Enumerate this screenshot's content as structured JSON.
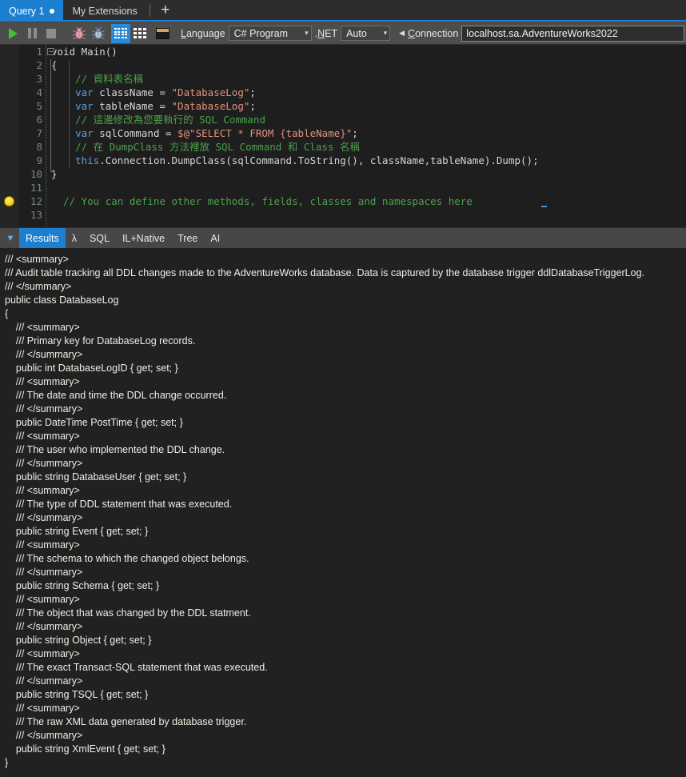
{
  "tabs": {
    "items": [
      {
        "label": "Query 1",
        "active": true,
        "dirty": true
      },
      {
        "label": "My Extensions",
        "active": false,
        "dirty": false
      }
    ],
    "add_label": "+"
  },
  "toolbar": {
    "icons": [
      {
        "name": "run-icon",
        "glyph": "play"
      },
      {
        "name": "pause-icon",
        "glyph": "pause"
      },
      {
        "name": "stop-icon",
        "glyph": "stop"
      },
      {
        "name": "debug-bug-pink-icon",
        "glyph": "bug-pink"
      },
      {
        "name": "debug-bug-blue-icon",
        "glyph": "bug-blue"
      },
      {
        "name": "results-grid-active-icon",
        "glyph": "grid4"
      },
      {
        "name": "results-grid-icon",
        "glyph": "grid3"
      },
      {
        "name": "panel-layout-icon",
        "glyph": "panel"
      }
    ],
    "language_label": "Language",
    "language_label_accesskey": "L",
    "language_value": "C# Program",
    "net_label": ".NET",
    "net_label_accesskey": "N",
    "net_value": "Auto",
    "connection_label": "Connection",
    "connection_label_accesskey": "C",
    "connection_value": "localhost.sa.AdventureWorks2022"
  },
  "editor": {
    "line_numbers": [
      "1",
      "2",
      "3",
      "4",
      "5",
      "6",
      "7",
      "8",
      "9",
      "10",
      "11",
      "12",
      "13"
    ],
    "lines": [
      [
        {
          "t": "void Main()",
          "c": "pln"
        }
      ],
      [
        {
          "t": "{",
          "c": "pln"
        }
      ],
      [
        {
          "t": "    // 資料表名稱",
          "c": "cmt"
        }
      ],
      [
        {
          "t": "    ",
          "c": "pln"
        },
        {
          "t": "var",
          "c": "kw"
        },
        {
          "t": " className = ",
          "c": "pln"
        },
        {
          "t": "\"DatabaseLog\"",
          "c": "str"
        },
        {
          "t": ";",
          "c": "pln"
        }
      ],
      [
        {
          "t": "    ",
          "c": "pln"
        },
        {
          "t": "var",
          "c": "kw"
        },
        {
          "t": " tableName = ",
          "c": "pln"
        },
        {
          "t": "\"DatabaseLog\"",
          "c": "str"
        },
        {
          "t": ";",
          "c": "pln"
        }
      ],
      [
        {
          "t": "    // 這邊修改為您要執行的 SQL Command",
          "c": "cmt"
        }
      ],
      [
        {
          "t": "    ",
          "c": "pln"
        },
        {
          "t": "var",
          "c": "kw"
        },
        {
          "t": " sqlCommand = ",
          "c": "pln"
        },
        {
          "t": "$@\"SELECT * FROM {tableName}\"",
          "c": "str"
        },
        {
          "t": ";",
          "c": "pln"
        }
      ],
      [
        {
          "t": "    // 在 DumpClass 方法裡放 SQL Command 和 Class 名稱",
          "c": "cmt"
        }
      ],
      [
        {
          "t": "    ",
          "c": "pln"
        },
        {
          "t": "this",
          "c": "kw"
        },
        {
          "t": ".Connection.DumpClass(sqlCommand.ToString(), className,tableName).Dump();",
          "c": "pln"
        }
      ],
      [
        {
          "t": "}",
          "c": "pln"
        }
      ],
      [
        {
          "t": "",
          "c": "pln"
        }
      ],
      [
        {
          "t": "  // You can define other methods, fields, classes and namespaces here",
          "c": "cmt"
        }
      ],
      [
        {
          "t": "",
          "c": "pln"
        }
      ]
    ],
    "bulb_line": 12,
    "bulb_name": "lightbulb-suggestion-icon"
  },
  "results_tabs": {
    "collapse_icon": "▼",
    "items": [
      {
        "label": "Results",
        "active": true
      },
      {
        "label": "λ",
        "active": false
      },
      {
        "label": "SQL",
        "active": false
      },
      {
        "label": "IL+Native",
        "active": false
      },
      {
        "label": "Tree",
        "active": false
      },
      {
        "label": "AI",
        "active": false
      }
    ]
  },
  "results": {
    "lines": [
      "/// <summary>",
      "/// Audit table tracking all DDL changes made to the AdventureWorks database. Data is captured by the database trigger ddlDatabaseTriggerLog.",
      "/// </summary>",
      "public class DatabaseLog",
      "{",
      "    /// <summary>",
      "    /// Primary key for DatabaseLog records.",
      "    /// </summary>",
      "    public int DatabaseLogID { get; set; }",
      "    /// <summary>",
      "    /// The date and time the DDL change occurred.",
      "    /// </summary>",
      "    public DateTime PostTime { get; set; }",
      "    /// <summary>",
      "    /// The user who implemented the DDL change.",
      "    /// </summary>",
      "    public string DatabaseUser { get; set; }",
      "    /// <summary>",
      "    /// The type of DDL statement that was executed.",
      "    /// </summary>",
      "    public string Event { get; set; }",
      "    /// <summary>",
      "    /// The schema to which the changed object belongs.",
      "    /// </summary>",
      "    public string Schema { get; set; }",
      "    /// <summary>",
      "    /// The object that was changed by the DDL statment.",
      "    /// </summary>",
      "    public string Object { get; set; }",
      "    /// <summary>",
      "    /// The exact Transact-SQL statement that was executed.",
      "    /// </summary>",
      "    public string TSQL { get; set; }",
      "    /// <summary>",
      "    /// The raw XML data generated by database trigger.",
      "    /// </summary>",
      "    public string XmlEvent { get; set; }",
      "}"
    ]
  },
  "colors": {
    "accent": "#1d7fd0",
    "toolbar_bg": "#4d4d4d",
    "tabbar_bg": "#2d2d2d",
    "editor_bg": "#1e1e1e",
    "results_bg": "#212121",
    "keyword": "#5f9fd8",
    "string": "#e0937c",
    "comment": "#4ea04e",
    "run_green": "#3fbf3f"
  }
}
